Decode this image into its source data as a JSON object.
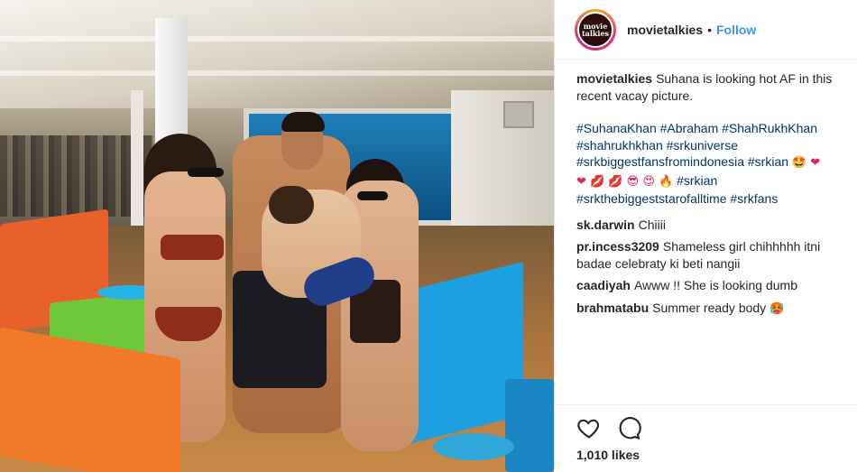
{
  "post": {
    "photo_alt": "Post photo"
  },
  "header": {
    "avatar_text": "movie talkies",
    "username": "movietalkies",
    "separator": "•",
    "follow_label": "Follow"
  },
  "caption": {
    "user": "movietalkies",
    "text": "Suhana is looking hot AF in this recent vacay picture.",
    "tags_line1": "#SuhanaKhan #Abraham #ShahRukhKhan",
    "tags_line2": "#shahrukhkhan #srkuniverse",
    "tags_line3": "#srkbiggestfansfromindonesia #srkian",
    "emoji_line3": "🤩 ❤",
    "emoji_line4": "❤ 💋 💋 😎 😍 🔥",
    "tags_line4": "#srkian",
    "tags_line5": "#srkthebiggeststarofalltime #srkfans"
  },
  "comments": [
    {
      "user": "sk.darwin",
      "text": "Chiiii"
    },
    {
      "user": "pr.incess3209",
      "text": "Shameless girl chihhhhh itni badae celebraty ki beti nangii"
    },
    {
      "user": "caadiyah",
      "text": "Awww !! She is looking dumb"
    },
    {
      "user": "brahmatabu",
      "text": "Summer ready body",
      "emoji": "🥵"
    }
  ],
  "actions": {
    "like_icon": "heart-outline-icon",
    "comment_icon": "comment-bubble-icon"
  },
  "likes": {
    "label": "1,010 likes"
  },
  "colors": {
    "link_blue": "#3897f0",
    "hashtag": "#003569",
    "text": "#262626",
    "border": "#efefef"
  }
}
